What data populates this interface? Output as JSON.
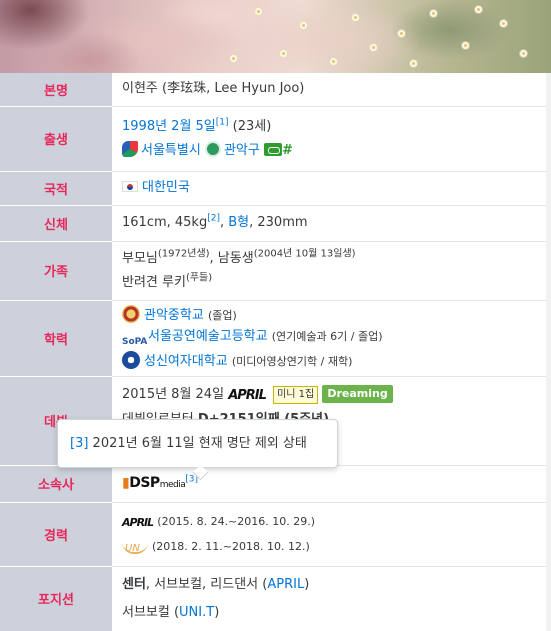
{
  "rows": {
    "name": {
      "label": "본명",
      "value": "이현주 (李玹珠, Lee Hyun Joo)"
    },
    "birth": {
      "label": "출생",
      "date": "1998년 2월 5일",
      "ref": "[1]",
      "age": " (23세)",
      "city": "서울특별시",
      "district": "관악구",
      "hash": "#"
    },
    "nationality": {
      "label": "국적",
      "value": "대한민국"
    },
    "body": {
      "label": "신체",
      "height_weight": "161cm, 45kg",
      "ref": "[2]",
      "sep1": ", ",
      "blood": "B형",
      "shoe": ", 230mm"
    },
    "family": {
      "label": "가족",
      "parents": "부모님",
      "parents_year": "(1972년생)",
      "brother": ", 남동생",
      "brother_date": "(2004년 10월 13일생)",
      "pet": "반려견 루키",
      "pet_breed": "(푸들)"
    },
    "education": {
      "label": "학력",
      "schools": [
        {
          "name": "관악중학교",
          "note": "(졸업)"
        },
        {
          "name": "서울공연예술고등학교",
          "note": "(연기예술과 6기 / 졸업)"
        },
        {
          "name": "성신여자대학교",
          "note": "(미디어영상연기학 / 재학)"
        }
      ]
    },
    "debut": {
      "label": "데뷔",
      "date": "2015년 8월 24일",
      "group_logo": "APRIL",
      "release_type": "미니 1집",
      "album": "Dreaming",
      "since_prefix": "데뷔일로부터 ",
      "since": "D+2151일째 (5주년)"
    },
    "agency": {
      "label": "소속사",
      "logo_main": "DSP",
      "logo_sub": "media",
      "ref": "[3]"
    },
    "career": {
      "label": "경력",
      "entries": [
        {
          "logo": "APRIL",
          "period": "(2015. 8. 24.~2016. 10. 29.)"
        },
        {
          "logo": "UNI.T",
          "period": "(2018. 2. 11.~2018. 10. 12.)"
        }
      ]
    },
    "position": {
      "label": "포지션",
      "main": "센터",
      "rest": ", 서브보컬, 리드댄서 (",
      "group1": "APRIL",
      "close1": ")",
      "second": "서브보컬 (",
      "group2": "UNI.T",
      "close2": ")"
    }
  },
  "tooltip": {
    "ref": "[3]",
    "text": " 2021년 6월 11일 현재 명단 제외 상태"
  },
  "icons": {
    "seoul": "seoul-emblem-icon",
    "gwanak": "gwanak-emblem-icon",
    "external": "external-link-icon"
  },
  "colors": {
    "label_bg": "#ccd1db",
    "label_text": "#e8275a",
    "link": "#0275d8",
    "album_badge": "#6bb34a"
  }
}
